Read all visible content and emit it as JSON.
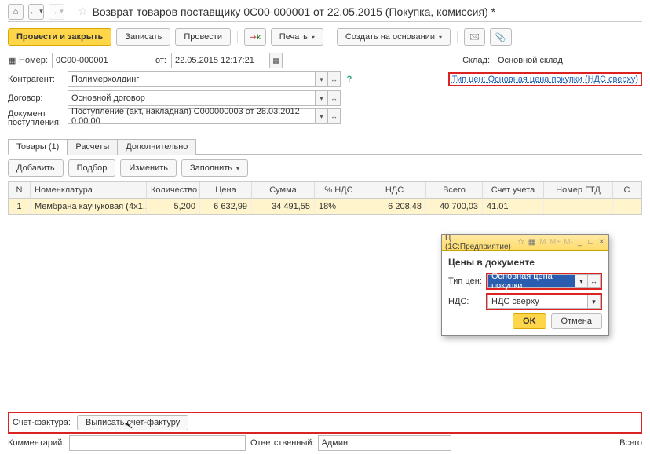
{
  "titlebar": {
    "title": "Возврат товаров поставщику 0С00-000001 от 22.05.2015 (Покупка, комиссия) *"
  },
  "toolbar": {
    "post_close": "Провести и закрыть",
    "save": "Записать",
    "post": "Провести",
    "print": "Печать",
    "base_on": "Создать на основании"
  },
  "form": {
    "number_lbl": "Номер:",
    "number": "0С00-000001",
    "from_lbl": "от:",
    "date": "22.05.2015 12:17:21",
    "warehouse_lbl": "Склад:",
    "warehouse": "Основной склад",
    "counterparty_lbl": "Контрагент:",
    "counterparty": "Полимерхолдинг",
    "price_type_link": "Тип цен: Основная цена покупки (НДС сверху)",
    "contract_lbl": "Договор:",
    "contract": "Основной договор",
    "receipt_lbl": "Документ\nпоступления:",
    "receipt": "Поступление (акт, накладная) С000000003 от 28.03.2012 0:00:00"
  },
  "tabs": {
    "goods": "Товары (1)",
    "calc": "Расчеты",
    "extra": "Дополнительно"
  },
  "inner_toolbar": {
    "add": "Добавить",
    "pick": "Подбор",
    "edit": "Изменить",
    "fill": "Заполнить"
  },
  "grid": {
    "headers": {
      "n": "N",
      "nomen": "Номенклатура",
      "qty": "Количество",
      "price": "Цена",
      "sum": "Сумма",
      "vatp": "% НДС",
      "vat": "НДС",
      "total": "Всего",
      "acct": "Счет учета",
      "gtd": "Номер ГТД",
      "last": "С"
    },
    "row": {
      "n": "1",
      "nomen": "Мембрана каучуковая (4х1...",
      "qty": "5,200",
      "price": "6 632,99",
      "sum": "34 491,55",
      "vatp": "18%",
      "vat": "6 208,48",
      "total": "40 700,03",
      "acct": "41.01",
      "gtd": ""
    }
  },
  "popup": {
    "caption": "Ц... (1С:Предприятие)",
    "title": "Цены в документе",
    "type_lbl": "Тип цен:",
    "type_val": "Основная цена покупки",
    "vat_lbl": "НДС:",
    "vat_val": "НДС сверху",
    "ok": "OK",
    "cancel": "Отмена"
  },
  "bottom": {
    "sf_lbl": "Счет-фактура:",
    "sf_btn": "Выписать счет-фактуру"
  },
  "comment": {
    "lbl": "Комментарий:",
    "resp_lbl": "Ответственный:",
    "resp": "Админ",
    "total_lbl": "Всего"
  }
}
